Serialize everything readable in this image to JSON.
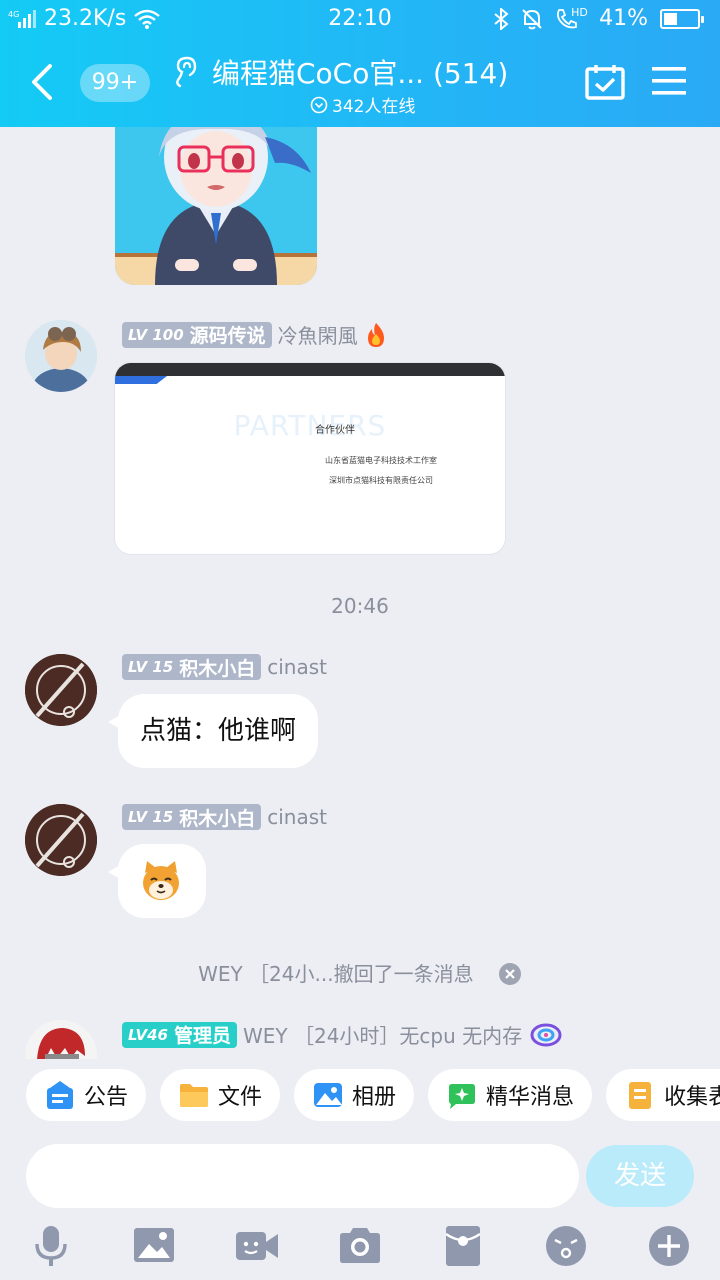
{
  "status_bar": {
    "network": "4G",
    "speed": "23.2K/s",
    "time": "22:10",
    "hd": "HD",
    "battery": "41%",
    "battery_level": 0.41
  },
  "header": {
    "unread": "99+",
    "title": "编程猫CoCo官... (514)",
    "online": "342人在线"
  },
  "messages": [
    {
      "type": "image",
      "description": "cartoon-girl-sticker"
    },
    {
      "badge_level": "100",
      "badge_title": "源码传说",
      "name": "冷魚閑風",
      "flair": "fire-icon",
      "type": "screenshot",
      "screenshot": {
        "heading": "PARTNERS",
        "subtitle": "合作伙伴",
        "lines": [
          "山东省蓝猫电子科技技术工作室",
          "深圳市点猫科技有限责任公司"
        ]
      }
    },
    {
      "type": "time",
      "text": "20:46"
    },
    {
      "badge_level": "15",
      "badge_title": "积木小白",
      "name": "cinast",
      "type": "text",
      "text": "点猫：他谁啊"
    },
    {
      "badge_level": "15",
      "badge_title": "积木小白",
      "name": "cinast",
      "type": "sticker",
      "sticker": "shiba-dog-emoji"
    },
    {
      "type": "recall",
      "text": "WEY ［24小...撤回了一条消息"
    },
    {
      "badge_level": "46",
      "badge_title": "管理员",
      "name": "WEY ［24小时］无cpu 无内存",
      "flair": "swirl-icon"
    }
  ],
  "quick_actions": [
    {
      "label": "公告",
      "icon": "announcement-icon"
    },
    {
      "label": "文件",
      "icon": "folder-icon"
    },
    {
      "label": "相册",
      "icon": "album-icon"
    },
    {
      "label": "精华消息",
      "icon": "essence-icon"
    },
    {
      "label": "收集表",
      "icon": "form-icon"
    }
  ],
  "composer": {
    "placeholder": "",
    "send_label": "发送"
  },
  "toolbar": [
    "microphone-icon",
    "image-icon",
    "video-call-icon",
    "camera-icon",
    "red-packet-icon",
    "emoji-icon",
    "plus-icon"
  ],
  "colors": {
    "header_start": "#14cbf5",
    "header_end": "#2aaaf5",
    "background": "#eceef4",
    "badge_gray": "#aeb6c9",
    "badge_admin": "#27cfc8",
    "send_disabled": "#b9ebfb"
  }
}
